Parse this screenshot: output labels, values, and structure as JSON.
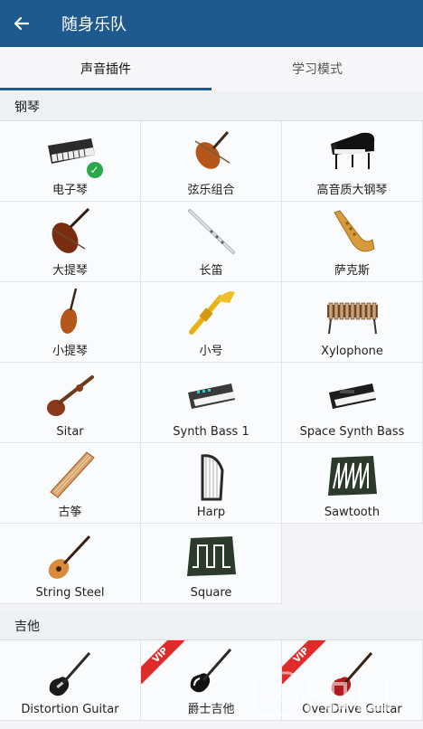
{
  "app": {
    "title": "随身乐队"
  },
  "tabs": [
    {
      "label": "声音插件"
    },
    {
      "label": "学习模式"
    }
  ],
  "sections": {
    "piano": {
      "title": "钢琴"
    },
    "guitar": {
      "title": "吉他"
    }
  },
  "instruments": [
    {
      "label": "电子琴",
      "icon": "keyboard-icon"
    },
    {
      "label": "弦乐组合",
      "icon": "violin-icon"
    },
    {
      "label": "高音质大钢琴",
      "icon": "grand-piano-icon"
    },
    {
      "label": "大提琴",
      "icon": "cello-icon"
    },
    {
      "label": "长笛",
      "icon": "flute-icon"
    },
    {
      "label": "萨克斯",
      "icon": "saxophone-icon"
    },
    {
      "label": "小提琴",
      "icon": "violin-icon"
    },
    {
      "label": "小号",
      "icon": "trumpet-icon"
    },
    {
      "label": "Xylophone",
      "icon": "xylophone-icon"
    },
    {
      "label": "Sitar",
      "icon": "sitar-icon"
    },
    {
      "label": "Synth Bass 1",
      "icon": "synth-icon"
    },
    {
      "label": "Space Synth Bass",
      "icon": "synth-icon"
    },
    {
      "label": "古筝",
      "icon": "guzheng-icon"
    },
    {
      "label": "Harp",
      "icon": "harp-icon"
    },
    {
      "label": "Sawtooth",
      "icon": "sawtooth-wave-icon"
    },
    {
      "label": "String Steel",
      "icon": "acoustic-guitar-icon"
    },
    {
      "label": "Square",
      "icon": "square-wave-icon"
    }
  ],
  "guitars": [
    {
      "label": "Distortion Guitar",
      "icon": "electric-guitar-icon",
      "vip": false
    },
    {
      "label": "爵士吉他",
      "icon": "electric-guitar-icon",
      "vip": true,
      "badge": "VIP"
    },
    {
      "label": "OverDrive Guitar",
      "icon": "electric-guitar-icon",
      "vip": true,
      "badge": "VIP"
    }
  ],
  "selected_instrument": "电子琴",
  "colors": {
    "appbar": "#1e5a8e",
    "vip": "#e02b2b",
    "check": "#2aa84a"
  }
}
